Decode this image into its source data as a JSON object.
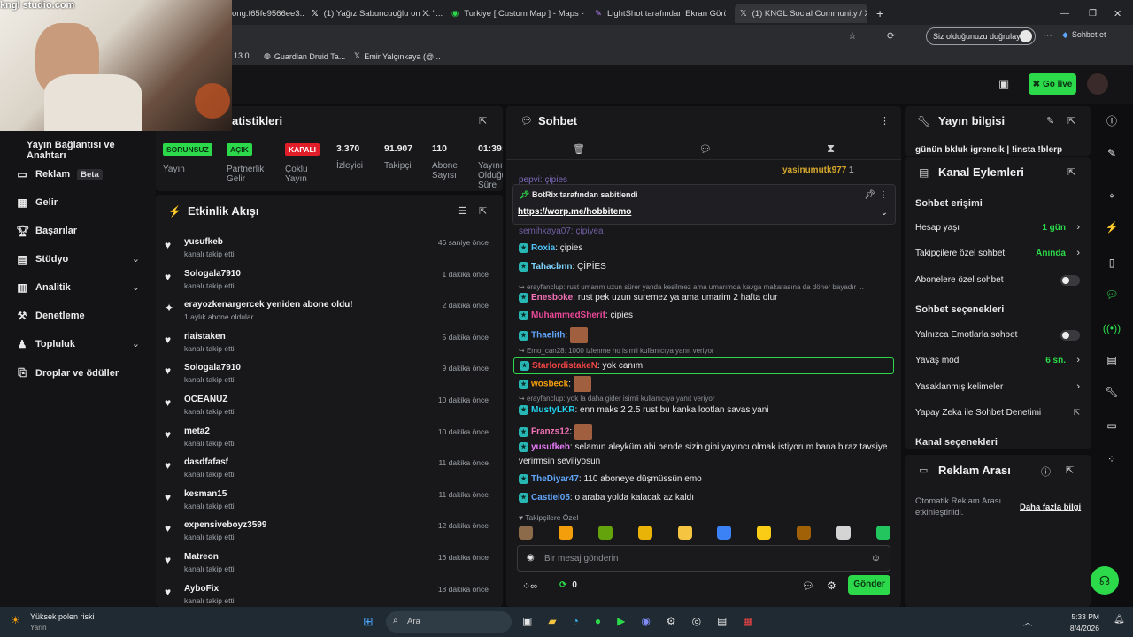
{
  "watermark": "kngl studio.com",
  "tabs": [
    {
      "label": "ong.f65fe9566ee3..."
    },
    {
      "label": "(1) Yağız Sabuncuoğlu on X: \"..."
    },
    {
      "label": "Turkiye [ Custom Map ] - Maps - G..."
    },
    {
      "label": "LightShot tarafından Ekran Görünt..."
    },
    {
      "label": "(1) KNGL Social Community / X"
    }
  ],
  "addr": {
    "verify": "Siz olduğunuzu doğrulayın",
    "chat_btn": "Sohbet et"
  },
  "bookmarks": [
    {
      "label": "13.0..."
    },
    {
      "label": "Guardian Druid Ta..."
    },
    {
      "label": "Emir Yalçınkaya (@..."
    }
  ],
  "topbar": {
    "golive": "Go live"
  },
  "leftnav": {
    "section": "Yayın Bağlantısı ve Anahtarı",
    "items": [
      {
        "label": "Reklam",
        "badge": "Beta"
      },
      {
        "label": "Gelir"
      },
      {
        "label": "Başarılar"
      },
      {
        "label": "Stüdyo"
      },
      {
        "label": "Analitik"
      },
      {
        "label": "Denetleme"
      },
      {
        "label": "Topluluk"
      },
      {
        "label": "Droplar ve ödüller"
      }
    ]
  },
  "stats": {
    "title": "atistikleri",
    "items": [
      {
        "badge": "SORUNSUZ",
        "label": "Yayın"
      },
      {
        "badge": "AÇIK",
        "label": "Partnerlik Gelir"
      },
      {
        "badge": "KAPALI",
        "label": "Çoklu Yayın"
      },
      {
        "value": "3.370",
        "label": "İzleyici"
      },
      {
        "value": "91.907",
        "label": "Takipçi"
      },
      {
        "value": "110",
        "label": "Abone Sayısı"
      },
      {
        "value": "01:39:",
        "label": "Yayını Olduğu Süre"
      }
    ]
  },
  "activity": {
    "title": "Etkinlik Akışı",
    "items": [
      {
        "name": "yusufkeb",
        "sub": "kanalı takip etti",
        "time": "46 saniye önce"
      },
      {
        "name": "Sologala7910",
        "sub": "kanalı takip etti",
        "time": "1 dakika önce"
      },
      {
        "name": "erayozkenargercek yeniden abone oldu!",
        "sub": "1 aylık abone oldular",
        "time": "2 dakika önce"
      },
      {
        "name": "riaistaken",
        "sub": "kanalı takip etti",
        "time": "5 dakika önce"
      },
      {
        "name": "Sologala7910",
        "sub": "kanalı takip etti",
        "time": "9 dakika önce"
      },
      {
        "name": "OCEANUZ",
        "sub": "kanalı takip etti",
        "time": "10 dakika önce"
      },
      {
        "name": "meta2",
        "sub": "kanalı takip etti",
        "time": "10 dakika önce"
      },
      {
        "name": "dasdfafasf",
        "sub": "kanalı takip etti",
        "time": "11 dakika önce"
      },
      {
        "name": "kesman15",
        "sub": "kanalı takip etti",
        "time": "11 dakika önce"
      },
      {
        "name": "expensiveboyz3599",
        "sub": "kanalı takip etti",
        "time": "12 dakika önce"
      },
      {
        "name": "Matreon",
        "sub": "kanalı takip etti",
        "time": "16 dakika önce"
      },
      {
        "name": "AyboFix",
        "sub": "kanalı takip etti",
        "time": "18 dakika önce"
      }
    ]
  },
  "chat": {
    "title": "Sohbet",
    "top_user": "yasinumutk977",
    "top_count": "1",
    "partial_top": "pepvi: çipies",
    "pinned": {
      "by": "BotRix tarafından sabitlendi",
      "link": "https://worp.me/hobbitemo"
    },
    "partial_under": "semihkaya07: çipiyea",
    "messages": [
      {
        "user": "Roxia",
        "text": "çipies",
        "color": "#4fc3f7"
      },
      {
        "user": "Tahacbnn",
        "text": "ÇİPİES",
        "color": "#7dd3fc"
      },
      {
        "reply": "erayfanclup: rust umarım uzun sürer yanda kesilmez ama umarımda kavga makarasına da döner bayadır ..."
      },
      {
        "user": "Enesboke",
        "text": "rust pek uzun suremez ya ama umarim 2 hafta olur",
        "color": "#f472b6"
      },
      {
        "user": "MuhammedSherif",
        "text": "çipies",
        "color": "#ec4899"
      },
      {
        "user": "Thaelith",
        "text": "",
        "color": "#60a5fa"
      },
      {
        "reply": "Emo_can28: 1000 izlenme ho isimli kullanıcıya yanıt veriyor"
      },
      {
        "user": "StarlordistakeN",
        "text": "yok canım",
        "color": "#ef4444"
      },
      {
        "user": "wosbeck",
        "text": "",
        "color": "#f59e0b"
      },
      {
        "reply": "erayfanclup: yok la daha gider isimli kullanıcıya yanıt veriyor"
      },
      {
        "user": "MustyLKR",
        "text": "enn maks 2 2.5 rust bu kanka lootlan savas yani",
        "color": "#22d3ee"
      },
      {
        "user": "Franzs12",
        "text": "",
        "color": "#f472b6"
      },
      {
        "user": "yusufkeb",
        "text": "selamın aleyküm abi bende sizin gibi yayıncı olmak istiyorum bana biraz tavsiye",
        "color": "#e879f9"
      },
      {
        "cont": "verirmsin seviliyosun"
      },
      {
        "user": "TheDiyar47",
        "text": "110 aboneye düşmüssün emo",
        "color": "#60a5fa"
      },
      {
        "user": "Castiel05",
        "text": "o araba yolda kalacak az kaldı",
        "color": "#60a5fa"
      }
    ],
    "followers_only": "Takipçilere Özel",
    "placeholder": "Bir mesaj gönderin",
    "points": "0",
    "send": "Gönder"
  },
  "info": {
    "title": "Yayın bilgisi",
    "text": "günün bkluk igrencik | !insta !blerp"
  },
  "actions": {
    "title": "Kanal Eylemleri",
    "access": "Sohbet erişimi",
    "rows": [
      {
        "label": "Hesap yaşı",
        "value": "1 gün"
      },
      {
        "label": "Takipçilere özel sohbet",
        "value": "Anında"
      },
      {
        "label": "Abonelere özel sohbet"
      }
    ],
    "options": "Sohbet seçenekleri",
    "rows2": [
      {
        "label": "Yalnızca Emotlarla sohbet"
      },
      {
        "label": "Yavaş mod",
        "value": "6 sn."
      },
      {
        "label": "Yasaklanmış kelimeler"
      },
      {
        "label": "Yapay Zeka ile Sohbet Denetimi"
      }
    ],
    "channel": "Kanal seçenekleri"
  },
  "ad": {
    "title": "Reklam Arası",
    "text": "Otomatik Reklam Arası etkinleştirildi.",
    "more": "Daha fazla bilgi"
  },
  "taskbar": {
    "weather_title": "Yüksek polen riski",
    "weather_sub": "Yarın",
    "search": "Ara",
    "time": "5:33 PM",
    "date": "8/4/2026"
  }
}
